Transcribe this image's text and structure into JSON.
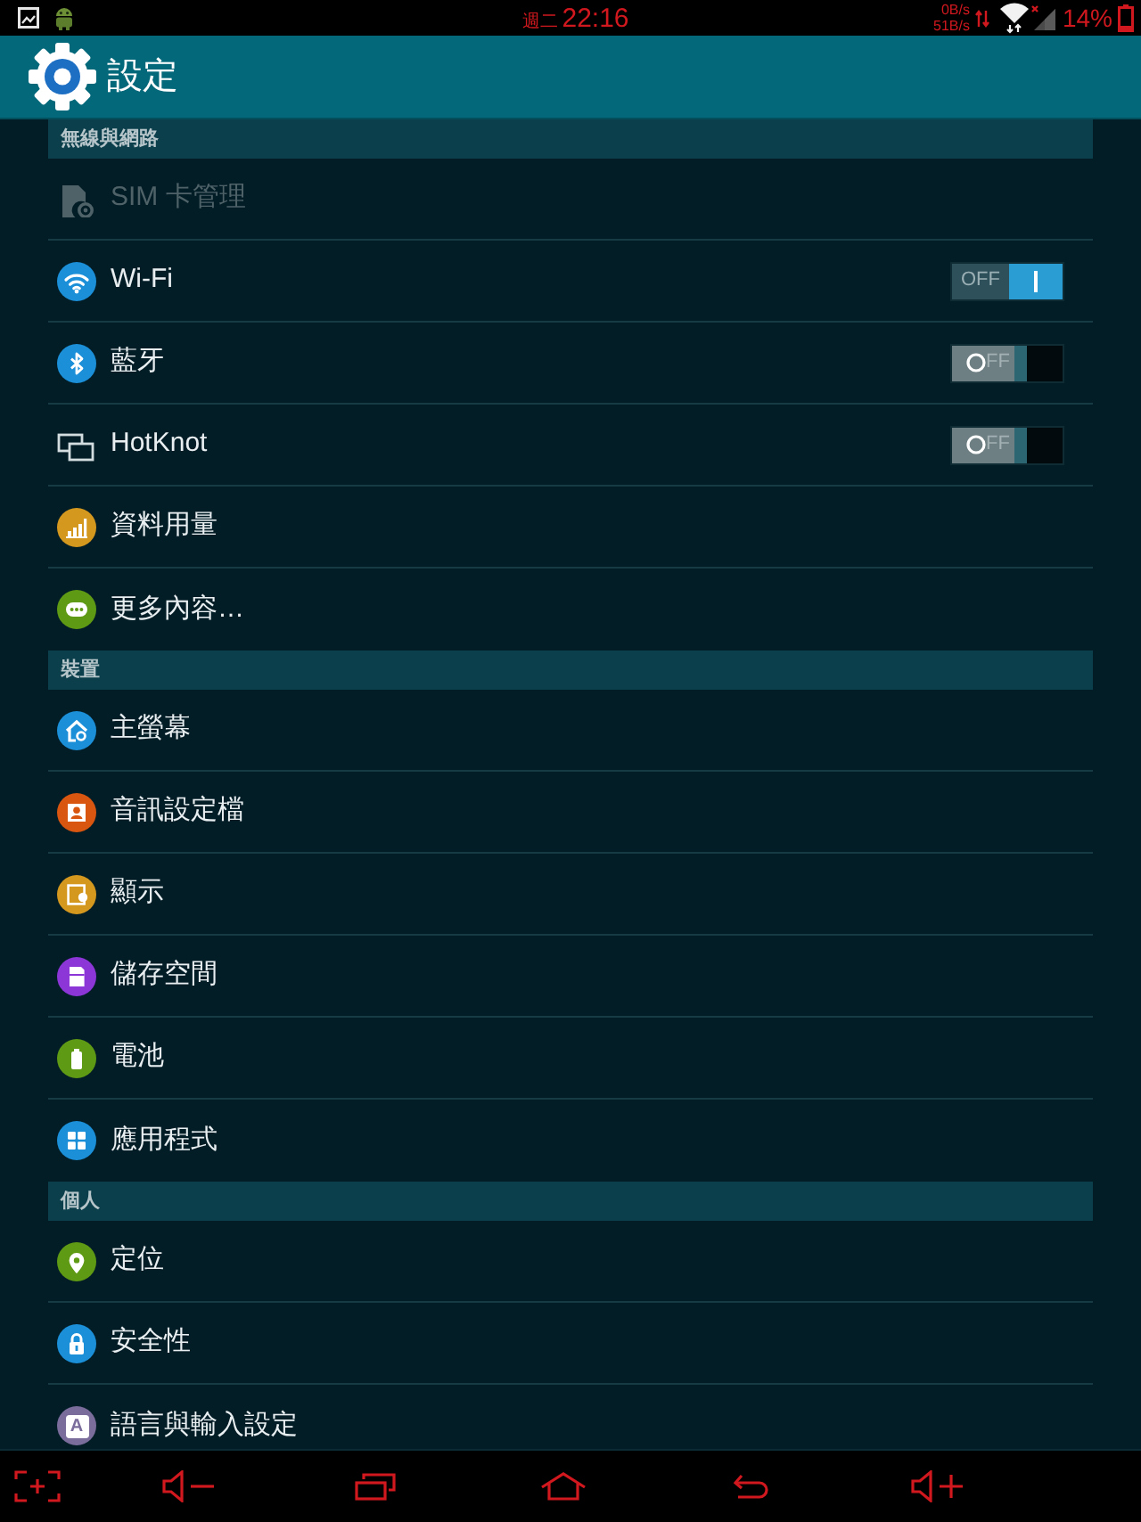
{
  "status_bar": {
    "day": "週二",
    "time": "22:16",
    "net_down": "0B/s",
    "net_up": "51B/s",
    "battery": "14%"
  },
  "header": {
    "title": "設定"
  },
  "sections": [
    {
      "title": "無線與網路",
      "items": [
        {
          "label": "SIM 卡管理",
          "disabled": true
        },
        {
          "label": "Wi-Fi",
          "disabled": false,
          "color": "#1b8fd8",
          "toggle": {
            "on": true,
            "label": "OFF"
          }
        },
        {
          "label": "藍牙",
          "disabled": false,
          "color": "#1b8fd8",
          "toggle": {
            "on": false,
            "label": "FF"
          }
        },
        {
          "label": "HotKnot",
          "disabled": false,
          "toggle": {
            "on": false,
            "label": "FF"
          }
        },
        {
          "label": "資料用量",
          "disabled": false,
          "color": "#d5981e"
        },
        {
          "label": "更多內容…",
          "disabled": false,
          "color": "#5f9a14"
        }
      ]
    },
    {
      "title": "裝置",
      "items": [
        {
          "label": "主螢幕",
          "disabled": false,
          "color": "#1b8fd8"
        },
        {
          "label": "音訊設定檔",
          "disabled": false,
          "color": "#d8560f"
        },
        {
          "label": "顯示",
          "disabled": false,
          "color": "#d5981e"
        },
        {
          "label": "儲存空間",
          "disabled": false,
          "color": "#8c36d8"
        },
        {
          "label": "電池",
          "disabled": false,
          "color": "#5f9a14"
        },
        {
          "label": "應用程式",
          "disabled": false,
          "color": "#1b8fd8"
        }
      ]
    },
    {
      "title": "個人",
      "items": [
        {
          "label": "定位",
          "disabled": false,
          "color": "#5f9a14"
        },
        {
          "label": "安全性",
          "disabled": false,
          "color": "#1b8fd8"
        },
        {
          "label": "語言與輸入設定",
          "disabled": false,
          "color": "#7a6d9c",
          "glyph": "A"
        }
      ]
    }
  ]
}
